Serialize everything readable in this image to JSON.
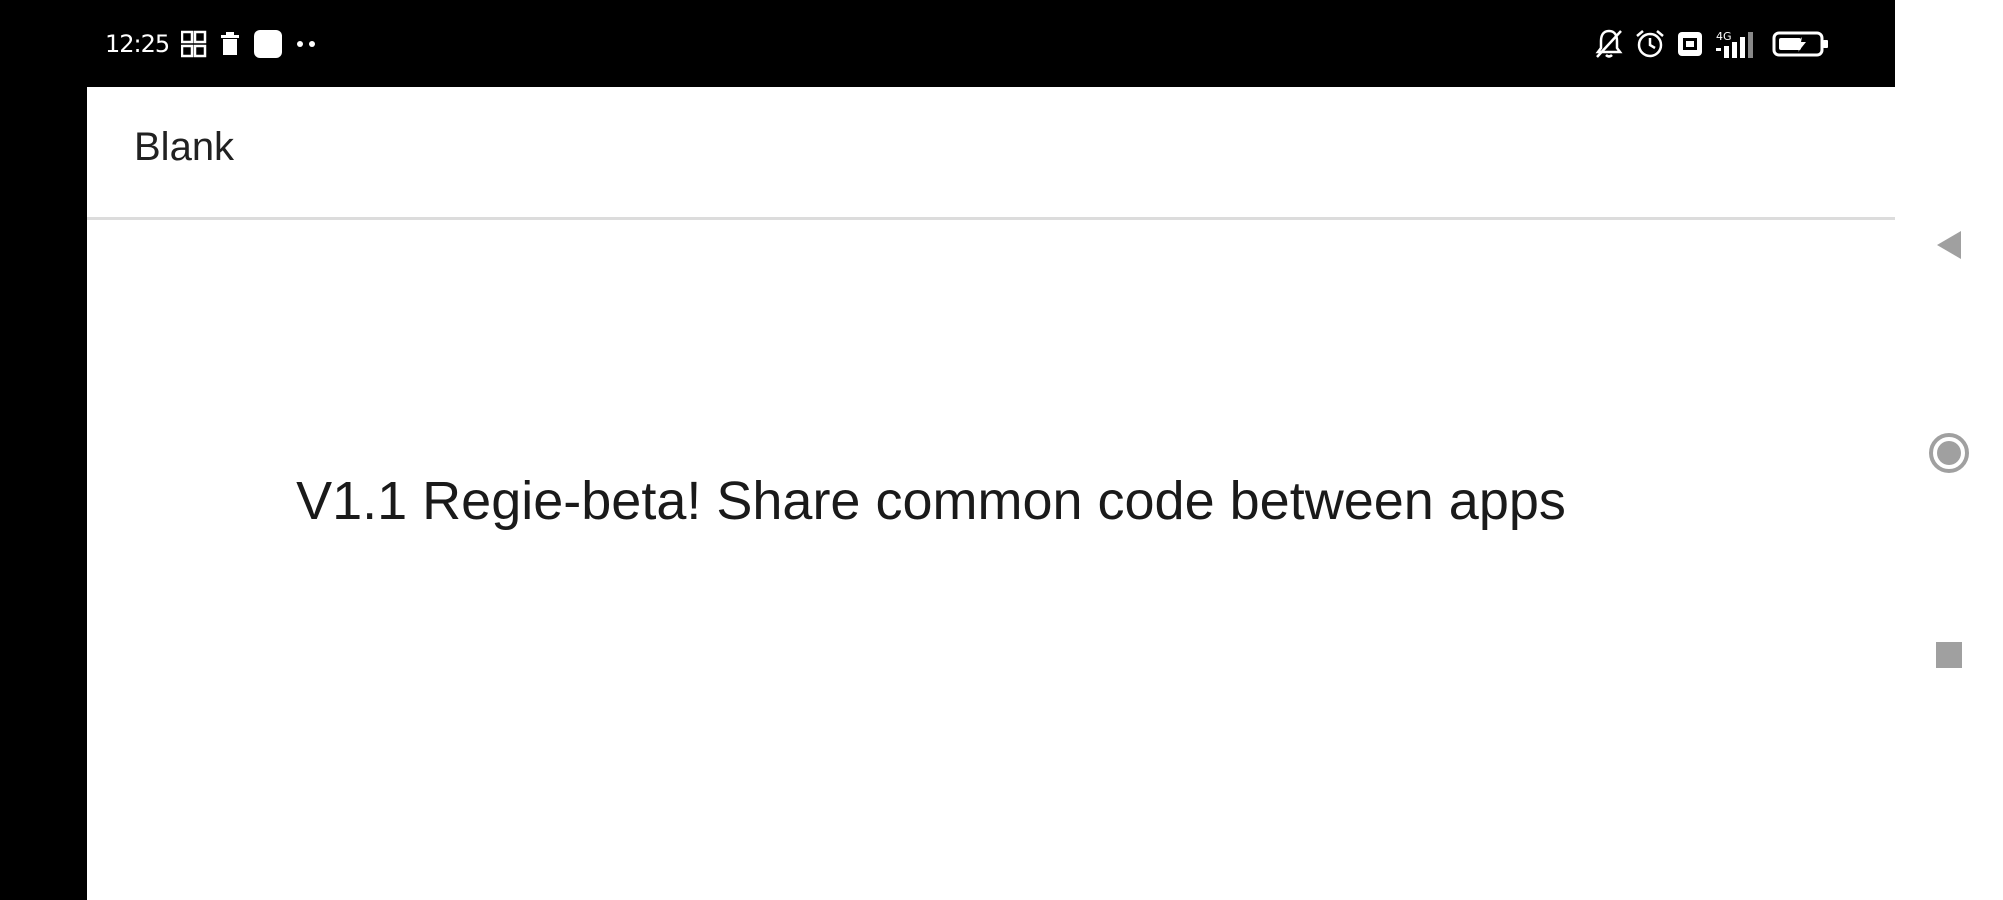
{
  "status_bar": {
    "time": "12:25",
    "left_icons": [
      "grid-app-icon",
      "trash-icon",
      "square-app-icon",
      "more-dots-icon"
    ],
    "right_icons": [
      "bell-off-icon",
      "alarm-clock-icon",
      "nfc-icon",
      "signal-icon",
      "battery-icon"
    ],
    "network_label": "4G"
  },
  "app_bar": {
    "title": "Blank"
  },
  "main": {
    "message": "V1.1 Regie-beta! Share common code between apps"
  },
  "navigation": {
    "buttons": [
      "back",
      "home",
      "recents"
    ]
  },
  "colors": {
    "status_bar_bg": "#000000",
    "app_bar_bg": "#ffffff",
    "text_primary": "#212121",
    "nav_icon": "#9e9e9e"
  }
}
